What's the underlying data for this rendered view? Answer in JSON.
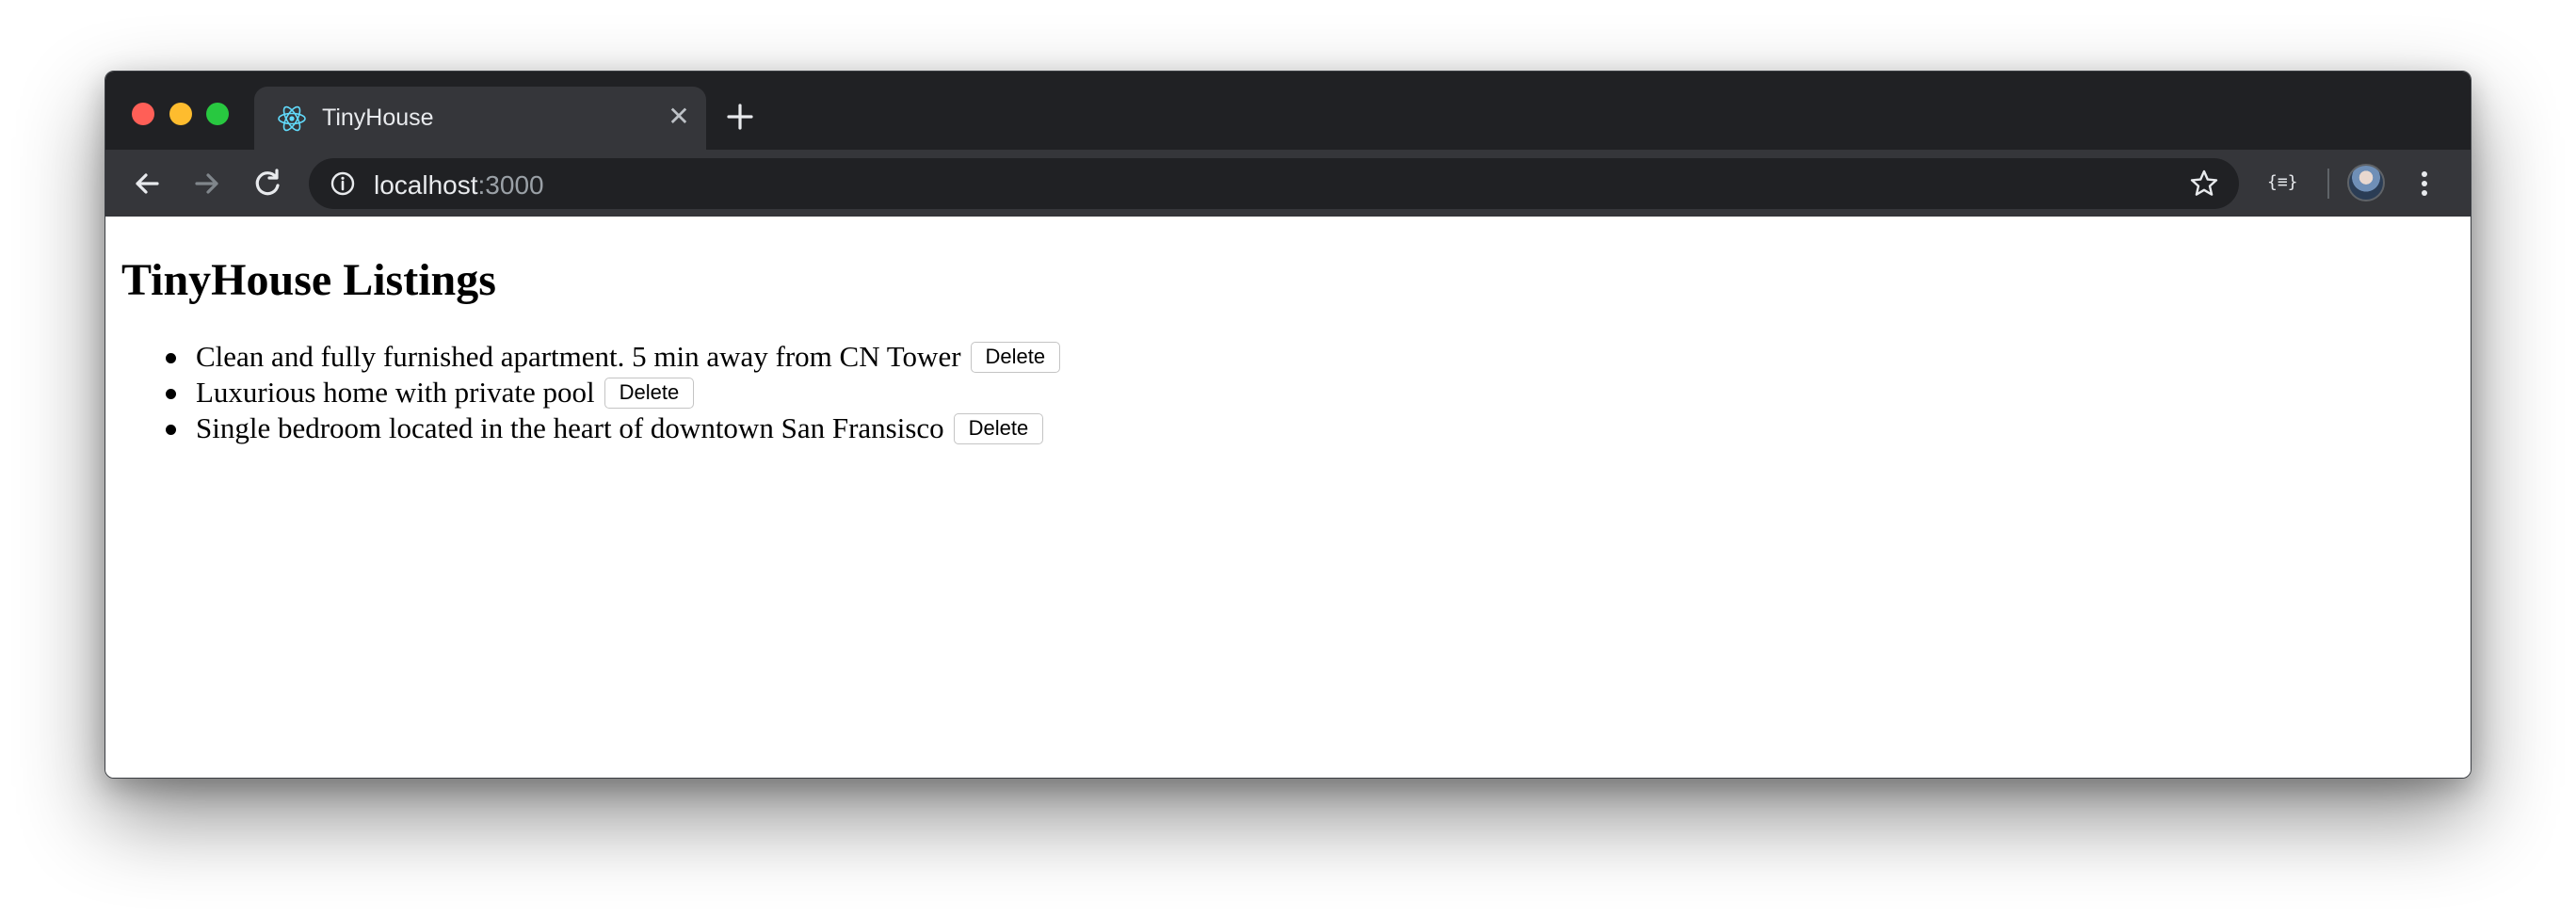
{
  "browser": {
    "tab_title": "TinyHouse",
    "url_host": "localhost",
    "url_port": ":3000",
    "extension_label": "{≡}",
    "close_glyph": "✕"
  },
  "icons": {
    "favicon": "react-logo-icon",
    "back": "arrow-left-icon",
    "forward": "arrow-right-icon",
    "reload": "reload-icon",
    "info": "info-icon",
    "bookmark": "star-icon",
    "menu": "kebab-menu-icon",
    "new_tab": "plus-icon"
  },
  "colors": {
    "tab_strip": "#202124",
    "toolbar": "#35363a",
    "react_blue": "#61dafb"
  },
  "page": {
    "title": "TinyHouse Listings",
    "listings": [
      {
        "title": "Clean and fully furnished apartment. 5 min away from CN Tower",
        "action": "Delete"
      },
      {
        "title": "Luxurious home with private pool",
        "action": "Delete"
      },
      {
        "title": "Single bedroom located in the heart of downtown San Fransisco",
        "action": "Delete"
      }
    ]
  }
}
